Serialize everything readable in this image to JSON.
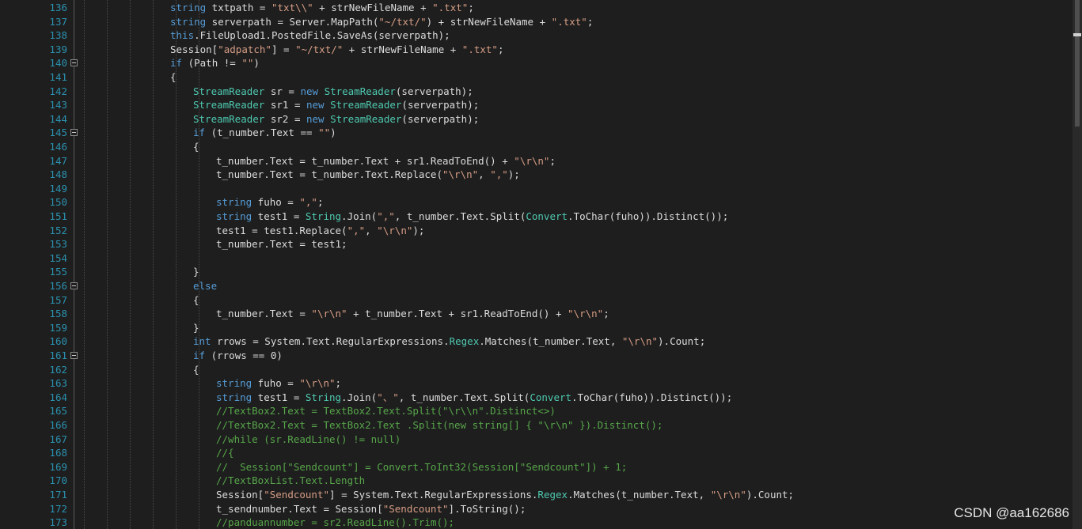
{
  "editor": {
    "lines": [
      {
        "num": "136",
        "tokens": [
          [
            "kw",
            "string"
          ],
          [
            "pl",
            " txtpath = "
          ],
          [
            "str",
            "\"txt\\\\\""
          ],
          [
            "pl",
            " + strNewFileName + "
          ],
          [
            "str",
            "\".txt\""
          ],
          [
            "pl",
            ";"
          ]
        ]
      },
      {
        "num": "137",
        "tokens": [
          [
            "kw",
            "string"
          ],
          [
            "pl",
            " serverpath = Server.MapPath("
          ],
          [
            "str",
            "\"~/txt/\""
          ],
          [
            "pl",
            ") + strNewFileName + "
          ],
          [
            "str",
            "\".txt\""
          ],
          [
            "pl",
            ";"
          ]
        ]
      },
      {
        "num": "138",
        "tokens": [
          [
            "kw",
            "this"
          ],
          [
            "pl",
            ".FileUpload1.PostedFile.SaveAs(serverpath);"
          ]
        ]
      },
      {
        "num": "139",
        "tokens": [
          [
            "pl",
            "Session["
          ],
          [
            "str",
            "\"adpatch\""
          ],
          [
            "pl",
            "] = "
          ],
          [
            "str",
            "\"~/txt/\""
          ],
          [
            "pl",
            " + strNewFileName + "
          ],
          [
            "str",
            "\".txt\""
          ],
          [
            "pl",
            ";"
          ]
        ]
      },
      {
        "num": "140",
        "tokens": [
          [
            "kw",
            "if"
          ],
          [
            "pl",
            " (Path != "
          ],
          [
            "str",
            "\"\""
          ],
          [
            "pl",
            ")"
          ]
        ]
      },
      {
        "num": "141",
        "tokens": [
          [
            "pl",
            "{"
          ]
        ]
      },
      {
        "num": "142",
        "tokens": [
          [
            "ty",
            "StreamReader"
          ],
          [
            "pl",
            " sr = "
          ],
          [
            "kw",
            "new"
          ],
          [
            "pl",
            " "
          ],
          [
            "ty",
            "StreamReader"
          ],
          [
            "pl",
            "(serverpath);"
          ]
        ]
      },
      {
        "num": "143",
        "tokens": [
          [
            "ty",
            "StreamReader"
          ],
          [
            "pl",
            " sr1 = "
          ],
          [
            "kw",
            "new"
          ],
          [
            "pl",
            " "
          ],
          [
            "ty",
            "StreamReader"
          ],
          [
            "pl",
            "(serverpath);"
          ]
        ]
      },
      {
        "num": "144",
        "tokens": [
          [
            "ty",
            "StreamReader"
          ],
          [
            "pl",
            " sr2 = "
          ],
          [
            "kw",
            "new"
          ],
          [
            "pl",
            " "
          ],
          [
            "ty",
            "StreamReader"
          ],
          [
            "pl",
            "(serverpath);"
          ]
        ]
      },
      {
        "num": "145",
        "tokens": [
          [
            "kw",
            "if"
          ],
          [
            "pl",
            " (t_number.Text == "
          ],
          [
            "str",
            "\"\""
          ],
          [
            "pl",
            ")"
          ]
        ]
      },
      {
        "num": "146",
        "tokens": [
          [
            "pl",
            "{"
          ]
        ]
      },
      {
        "num": "147",
        "tokens": [
          [
            "pl",
            "t_number.Text = t_number.Text + sr1.ReadToEnd() + "
          ],
          [
            "str",
            "\"\\r\\n\""
          ],
          [
            "pl",
            ";"
          ]
        ]
      },
      {
        "num": "148",
        "tokens": [
          [
            "pl",
            "t_number.Text = t_number.Text.Replace("
          ],
          [
            "str",
            "\"\\r\\n\""
          ],
          [
            "pl",
            ", "
          ],
          [
            "str",
            "\",\""
          ],
          [
            "pl",
            ");"
          ]
        ]
      },
      {
        "num": "149",
        "tokens": []
      },
      {
        "num": "150",
        "tokens": [
          [
            "kw",
            "string"
          ],
          [
            "pl",
            " fuho = "
          ],
          [
            "str",
            "\",\""
          ],
          [
            "pl",
            ";"
          ]
        ]
      },
      {
        "num": "151",
        "tokens": [
          [
            "kw",
            "string"
          ],
          [
            "pl",
            " test1 = "
          ],
          [
            "ty",
            "String"
          ],
          [
            "pl",
            ".Join("
          ],
          [
            "str",
            "\",\""
          ],
          [
            "pl",
            ", t_number.Text.Split("
          ],
          [
            "ty",
            "Convert"
          ],
          [
            "pl",
            ".ToChar(fuho)).Distinct());"
          ]
        ]
      },
      {
        "num": "152",
        "tokens": [
          [
            "pl",
            "test1 = test1.Replace("
          ],
          [
            "str",
            "\",\""
          ],
          [
            "pl",
            ", "
          ],
          [
            "str",
            "\"\\r\\n\""
          ],
          [
            "pl",
            ");"
          ]
        ]
      },
      {
        "num": "153",
        "tokens": [
          [
            "pl",
            "t_number.Text = test1;"
          ]
        ]
      },
      {
        "num": "154",
        "tokens": []
      },
      {
        "num": "155",
        "tokens": [
          [
            "pl",
            "}"
          ]
        ]
      },
      {
        "num": "156",
        "tokens": [
          [
            "kw",
            "else"
          ]
        ]
      },
      {
        "num": "157",
        "tokens": [
          [
            "pl",
            "{"
          ]
        ]
      },
      {
        "num": "158",
        "tokens": [
          [
            "pl",
            "t_number.Text = "
          ],
          [
            "str",
            "\"\\r\\n\""
          ],
          [
            "pl",
            " + t_number.Text + sr1.ReadToEnd() + "
          ],
          [
            "str",
            "\"\\r\\n\""
          ],
          [
            "pl",
            ";"
          ]
        ]
      },
      {
        "num": "159",
        "tokens": [
          [
            "pl",
            "}"
          ]
        ]
      },
      {
        "num": "160",
        "tokens": [
          [
            "kw",
            "int"
          ],
          [
            "pl",
            " rrows = System.Text.RegularExpressions."
          ],
          [
            "ty",
            "Regex"
          ],
          [
            "pl",
            ".Matches(t_number.Text, "
          ],
          [
            "str",
            "\"\\r\\n\""
          ],
          [
            "pl",
            ").Count;"
          ]
        ]
      },
      {
        "num": "161",
        "tokens": [
          [
            "kw",
            "if"
          ],
          [
            "pl",
            " (rrows == 0)"
          ]
        ]
      },
      {
        "num": "162",
        "tokens": [
          [
            "pl",
            "{"
          ]
        ]
      },
      {
        "num": "163",
        "tokens": [
          [
            "kw",
            "string"
          ],
          [
            "pl",
            " fuho = "
          ],
          [
            "str",
            "\"\\r\\n\""
          ],
          [
            "pl",
            ";"
          ]
        ]
      },
      {
        "num": "164",
        "tokens": [
          [
            "kw",
            "string"
          ],
          [
            "pl",
            " test1 = "
          ],
          [
            "ty",
            "String"
          ],
          [
            "pl",
            ".Join("
          ],
          [
            "str",
            "\"、\""
          ],
          [
            "pl",
            ", t_number.Text.Split("
          ],
          [
            "ty",
            "Convert"
          ],
          [
            "pl",
            ".ToChar(fuho)).Distinct());"
          ]
        ]
      },
      {
        "num": "165",
        "tokens": [
          [
            "cm",
            "//TextBox2.Text = TextBox2.Text.Split(\"\\r\\\\n\".Distinct<>)"
          ]
        ]
      },
      {
        "num": "166",
        "tokens": [
          [
            "cm",
            "//TextBox2.Text = TextBox2.Text .Split(new string[] { \"\\r\\n\" }).Distinct();"
          ]
        ]
      },
      {
        "num": "167",
        "tokens": [
          [
            "cm",
            "//while (sr.ReadLine() != null)"
          ]
        ]
      },
      {
        "num": "168",
        "tokens": [
          [
            "cm",
            "//{"
          ]
        ]
      },
      {
        "num": "169",
        "tokens": [
          [
            "cm",
            "//  Session[\"Sendcount\"] = Convert.ToInt32(Session[\"Sendcount\"]) + 1;"
          ]
        ]
      },
      {
        "num": "170",
        "tokens": [
          [
            "cm",
            "//TextBoxList.Text.Length"
          ]
        ]
      },
      {
        "num": "171",
        "tokens": [
          [
            "pl",
            "Session["
          ],
          [
            "str",
            "\"Sendcount\""
          ],
          [
            "pl",
            "] = System.Text.RegularExpressions."
          ],
          [
            "ty",
            "Regex"
          ],
          [
            "pl",
            ".Matches(t_number.Text, "
          ],
          [
            "str",
            "\"\\r\\n\""
          ],
          [
            "pl",
            ").Count;"
          ]
        ]
      },
      {
        "num": "172",
        "tokens": [
          [
            "pl",
            "t_sendnumber.Text = Session["
          ],
          [
            "str",
            "\"Sendcount\""
          ],
          [
            "pl",
            "].ToString();"
          ]
        ]
      },
      {
        "num": "173",
        "tokens": [
          [
            "cm",
            "//panduannumber = sr2.ReadLine().Trim();"
          ]
        ]
      }
    ]
  },
  "watermark": "CSDN @aa162686"
}
